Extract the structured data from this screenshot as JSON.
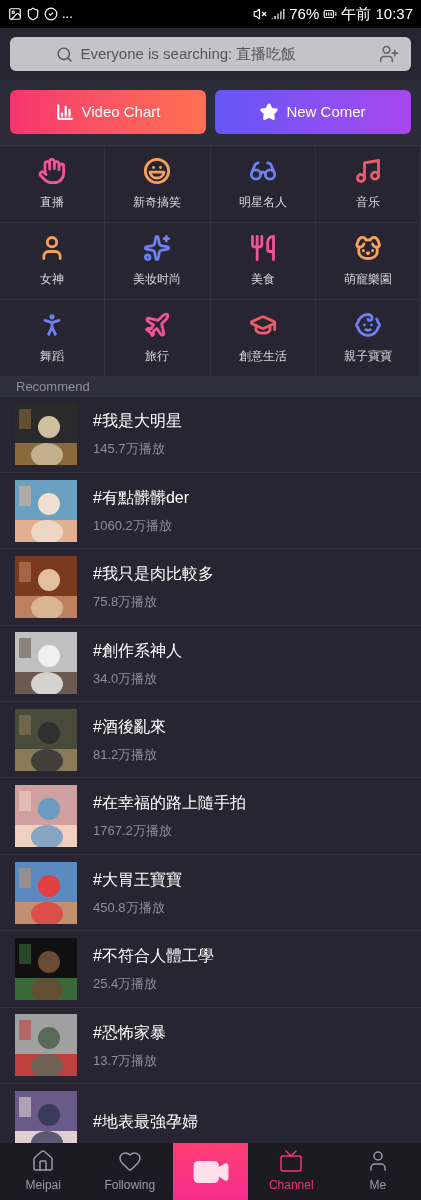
{
  "status_bar": {
    "ellipsis": "...",
    "battery": "76%",
    "time": "午前 10:37"
  },
  "search": {
    "placeholder": "Everyone is searching: 直播吃飯"
  },
  "banners": [
    {
      "kind": "chart",
      "label": "Video Chart"
    },
    {
      "kind": "star",
      "label": "New Comer"
    }
  ],
  "categories": [
    {
      "kind": "hand",
      "label": "直播",
      "color": "#f0559a"
    },
    {
      "kind": "laugh",
      "label": "新奇搞笑",
      "color": "#f6a25a"
    },
    {
      "kind": "glasses",
      "label": "明星名人",
      "color": "#6f7ff0"
    },
    {
      "kind": "music",
      "label": "音乐",
      "color": "#f05a6c"
    },
    {
      "kind": "woman",
      "label": "女神",
      "color": "#f6a25a"
    },
    {
      "kind": "makeup",
      "label": "美妆时尚",
      "color": "#6f7ff0"
    },
    {
      "kind": "food",
      "label": "美食",
      "color": "#f0559a"
    },
    {
      "kind": "dog",
      "label": "萌寵樂園",
      "color": "#f6a25a"
    },
    {
      "kind": "dance",
      "label": "舞蹈",
      "color": "#6f7ff0"
    },
    {
      "kind": "plane",
      "label": "旅行",
      "color": "#f0559a"
    },
    {
      "kind": "cap",
      "label": "創意生活",
      "color": "#f05a6c"
    },
    {
      "kind": "pacifier",
      "label": "親子寶寶",
      "color": "#6f7ff0"
    }
  ],
  "section_title": "Recommend",
  "topics": [
    {
      "title": "#我是大明星",
      "count": "145.7万播放"
    },
    {
      "title": "#有點髒髒der",
      "count": "1060.2万播放"
    },
    {
      "title": "#我只是肉比較多",
      "count": "75.8万播放"
    },
    {
      "title": "#創作系神人",
      "count": "34.0万播放"
    },
    {
      "title": "#酒後亂來",
      "count": "81.2万播放"
    },
    {
      "title": "#在幸福的路上隨手拍",
      "count": "1767.2万播放"
    },
    {
      "title": "#大胃王寶寶",
      "count": "450.8万播放"
    },
    {
      "title": "#不符合人體工學",
      "count": "25.4万播放"
    },
    {
      "title": "#恐怖家暴",
      "count": "13.7万播放"
    },
    {
      "title": "#地表最強孕婦"
    }
  ],
  "nav": [
    {
      "kind": "home",
      "label": "Meipai",
      "selected": false
    },
    {
      "kind": "heart",
      "label": "Following",
      "selected": false
    },
    {
      "kind": "camera"
    },
    {
      "kind": "tv",
      "label": "Channel",
      "selected": true
    },
    {
      "kind": "user",
      "label": "Me",
      "selected": false
    }
  ]
}
